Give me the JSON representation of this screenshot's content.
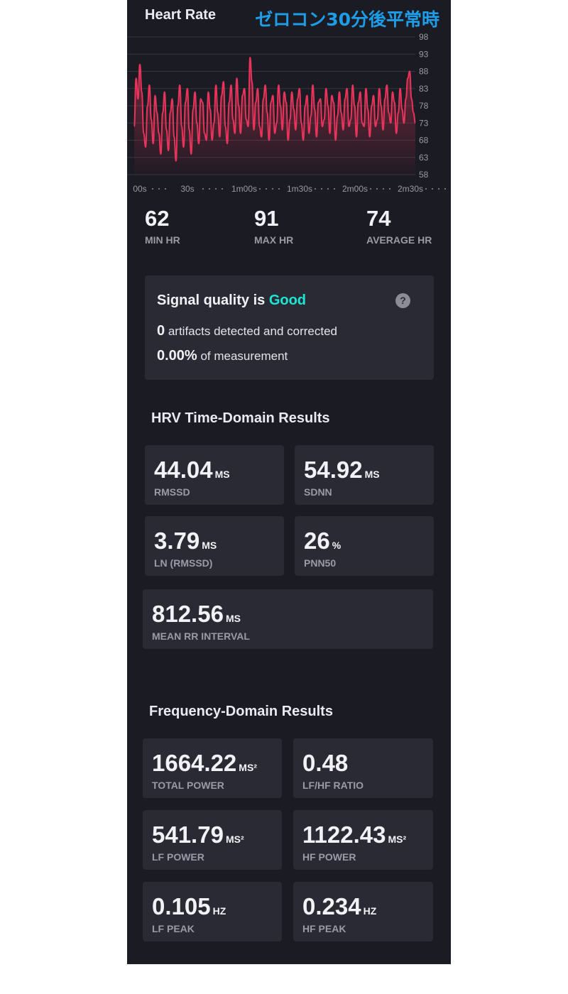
{
  "header": {
    "title": "Heart Rate",
    "annotation": "ゼロコン30分後平常時"
  },
  "chart_data": {
    "type": "line",
    "title": "Heart Rate",
    "y_ticks": [
      98,
      93,
      88,
      83,
      78,
      73,
      68,
      63,
      58
    ],
    "x_ticks": [
      "00s",
      "30s",
      "1m00s",
      "1m30s",
      "2m00s",
      "2m30s"
    ],
    "ylim": [
      58,
      98
    ],
    "xlim": [
      0,
      160
    ],
    "grid": true,
    "color": "#e8345a",
    "series": [
      {
        "values": [
          72,
          86,
          80,
          90,
          82,
          70,
          66,
          78,
          84,
          74,
          67,
          81,
          76,
          70,
          64,
          76,
          82,
          71,
          65,
          76,
          80,
          69,
          62,
          78,
          84,
          72,
          66,
          79,
          83,
          71,
          64,
          77,
          82,
          73,
          67,
          80,
          79,
          70,
          68,
          82,
          77,
          68,
          73,
          84,
          76,
          69,
          81,
          85,
          72,
          67,
          79,
          84,
          74,
          70,
          86,
          78,
          70,
          81,
          83,
          74,
          72,
          92,
          85,
          71,
          79,
          83,
          72,
          69,
          80,
          84,
          76,
          68,
          79,
          81,
          70,
          73,
          84,
          78,
          71,
          82,
          79,
          68,
          74,
          82,
          77,
          71,
          80,
          83,
          73,
          68,
          78,
          81,
          70,
          75,
          84,
          77,
          69,
          79,
          80,
          72,
          74,
          83,
          78,
          70,
          81,
          79,
          68,
          75,
          82,
          76,
          71,
          80,
          83,
          72,
          74,
          84,
          78,
          69,
          79,
          82,
          73,
          72,
          83,
          77,
          69,
          78,
          81,
          72,
          74,
          83,
          78,
          71,
          80,
          84,
          76,
          73,
          82,
          79,
          70,
          76,
          83,
          77,
          73,
          80,
          86,
          88,
          80,
          76,
          73
        ]
      }
    ]
  },
  "stats": [
    {
      "value": "62",
      "label": "MIN HR"
    },
    {
      "value": "91",
      "label": "MAX HR"
    },
    {
      "value": "74",
      "label": "AVERAGE HR"
    }
  ],
  "signal": {
    "prefix": "Signal quality is ",
    "quality": "Good",
    "help": "?",
    "artifacts_count": "0",
    "artifacts_text": " artifacts detected and corrected",
    "percent": "0.00%",
    "percent_text": " of measurement"
  },
  "time_domain": {
    "title": "HRV Time-Domain Results",
    "metrics": [
      {
        "value": "44.04",
        "unit": "MS",
        "label": "RMSSD"
      },
      {
        "value": "54.92",
        "unit": "MS",
        "label": "SDNN"
      },
      {
        "value": "3.79",
        "unit": "MS",
        "label": "LN (RMSSD)"
      },
      {
        "value": "26",
        "unit": "%",
        "label": "PNN50"
      },
      {
        "value": "812.56",
        "unit": "MS",
        "label": "MEAN RR INTERVAL"
      }
    ]
  },
  "frequency_domain": {
    "title": "Frequency-Domain Results",
    "metrics": [
      {
        "value": "1664.22",
        "unit": "MS²",
        "label": "TOTAL POWER"
      },
      {
        "value": "0.48",
        "unit": "",
        "label": "LF/HF RATIO"
      },
      {
        "value": "541.79",
        "unit": "MS²",
        "label": "LF POWER"
      },
      {
        "value": "1122.43",
        "unit": "MS²",
        "label": "HF POWER"
      },
      {
        "value": "0.105",
        "unit": "HZ",
        "label": "LF PEAK"
      },
      {
        "value": "0.234",
        "unit": "HZ",
        "label": "HF PEAK"
      }
    ]
  }
}
